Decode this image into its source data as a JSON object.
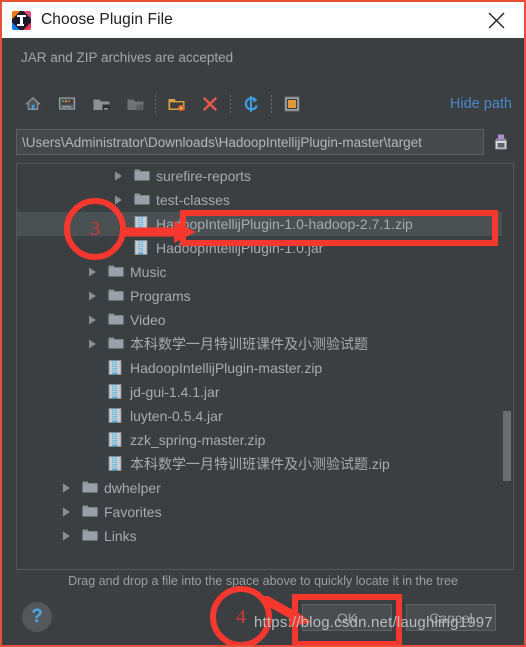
{
  "window": {
    "title": "Choose Plugin File",
    "logo_icon": "intellij-idea-logo",
    "close_icon": "close-icon",
    "subtitle": "JAR and ZIP archives are accepted"
  },
  "toolbar": {
    "buttons": [
      {
        "name": "home-icon",
        "tooltip": "Home"
      },
      {
        "name": "desktop-icon",
        "tooltip": "Desktop"
      },
      {
        "name": "project-folder-icon",
        "tooltip": "Project"
      },
      {
        "name": "module-folder-icon",
        "tooltip": "Module"
      },
      {
        "name": "new-folder-icon",
        "tooltip": "New Folder"
      },
      {
        "name": "delete-icon",
        "tooltip": "Delete"
      },
      {
        "name": "refresh-icon",
        "tooltip": "Refresh"
      },
      {
        "name": "show-hidden-icon",
        "tooltip": "Show Hidden Files"
      }
    ],
    "hide_path_label": "Hide path"
  },
  "path": {
    "value": "\\Users\\Administrator\\Downloads\\HadoopIntellijPlugin-master\\target",
    "save_icon": "save-path-icon"
  },
  "tree": {
    "rows": [
      {
        "indent": 3,
        "twisty": "collapsed",
        "icon": "folder",
        "label": "surefire-reports",
        "selected": false
      },
      {
        "indent": 3,
        "twisty": "collapsed",
        "icon": "folder",
        "label": "test-classes",
        "selected": false
      },
      {
        "indent": 3,
        "twisty": "none",
        "icon": "archive",
        "label": "HadoopIntellijPlugin-1.0-hadoop-2.7.1.zip",
        "selected": true
      },
      {
        "indent": 3,
        "twisty": "none",
        "icon": "archive",
        "label": "HadoopIntellijPlugin-1.0.jar",
        "selected": false
      },
      {
        "indent": 2,
        "twisty": "collapsed",
        "icon": "folder",
        "label": "Music",
        "selected": false
      },
      {
        "indent": 2,
        "twisty": "collapsed",
        "icon": "folder",
        "label": "Programs",
        "selected": false
      },
      {
        "indent": 2,
        "twisty": "collapsed",
        "icon": "folder",
        "label": "Video",
        "selected": false
      },
      {
        "indent": 2,
        "twisty": "collapsed",
        "icon": "folder",
        "label": "本科数学一月特训班课件及小测验试题",
        "selected": false
      },
      {
        "indent": 2,
        "twisty": "none",
        "icon": "archive",
        "label": "HadoopIntellijPlugin-master.zip",
        "selected": false
      },
      {
        "indent": 2,
        "twisty": "none",
        "icon": "archive",
        "label": "jd-gui-1.4.1.jar",
        "selected": false
      },
      {
        "indent": 2,
        "twisty": "none",
        "icon": "archive",
        "label": "luyten-0.5.4.jar",
        "selected": false
      },
      {
        "indent": 2,
        "twisty": "none",
        "icon": "archive",
        "label": "zzk_spring-master.zip",
        "selected": false
      },
      {
        "indent": 2,
        "twisty": "none",
        "icon": "archive",
        "label": "本科数学一月特训班课件及小测验试题.zip",
        "selected": false
      },
      {
        "indent": 1,
        "twisty": "collapsed",
        "icon": "folder",
        "label": "dwhelper",
        "selected": false
      },
      {
        "indent": 1,
        "twisty": "collapsed",
        "icon": "folder",
        "label": "Favorites",
        "selected": false
      },
      {
        "indent": 1,
        "twisty": "collapsed",
        "icon": "folder",
        "label": "Links",
        "selected": false
      }
    ],
    "scrollbar": "vertical-scrollbar"
  },
  "hint": "Drag and drop a file into the space above to quickly locate it in the tree",
  "footer": {
    "help_label": "?",
    "ok_label": "OK",
    "cancel_label": "Cancel"
  },
  "annotations": {
    "step3": "3",
    "step4": "4",
    "watermark": "https://blog.csdn.net/laughling1997",
    "accent_color": "#f8382f"
  }
}
